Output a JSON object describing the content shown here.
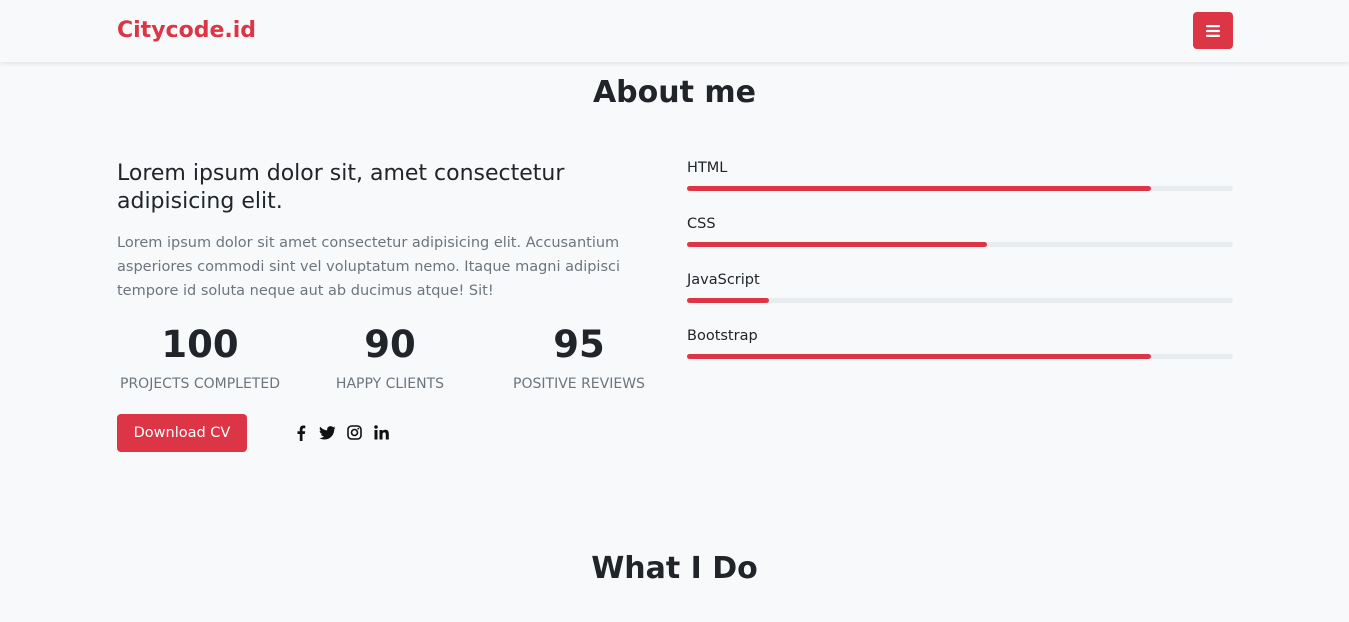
{
  "navbar": {
    "brand": "Citycode.id",
    "menu_icon": "hamburger-menu-icon"
  },
  "about": {
    "title": "About me",
    "heading": "Lorem ipsum dolor sit, amet consectetur adipisicing elit.",
    "text": "Lorem ipsum dolor sit amet consectetur adipisicing elit. Accusantium asperiores commodi sint vel voluptatum nemo. Itaque magni adipisci tempore id soluta neque aut ab ducimus atque! Sit!",
    "stats": [
      {
        "value": "100",
        "label": "PROJECTS COMPLETED"
      },
      {
        "value": "90",
        "label": "HAPPY CLIENTS"
      },
      {
        "value": "95",
        "label": "POSITIVE REVIEWS"
      }
    ],
    "download_label": "Download CV",
    "socials": [
      "facebook-icon",
      "twitter-icon",
      "instagram-icon",
      "linkedin-icon"
    ],
    "skills": [
      {
        "name": "HTML",
        "level": 85
      },
      {
        "name": "CSS",
        "level": 55
      },
      {
        "name": "JavaScript",
        "level": 15
      },
      {
        "name": "Bootstrap",
        "level": 85
      }
    ]
  },
  "whatido": {
    "title": "What I Do"
  },
  "colors": {
    "accent": "#dc3545",
    "background": "#f8f9fa",
    "muted": "#6c757d",
    "track": "#e9ecef"
  }
}
